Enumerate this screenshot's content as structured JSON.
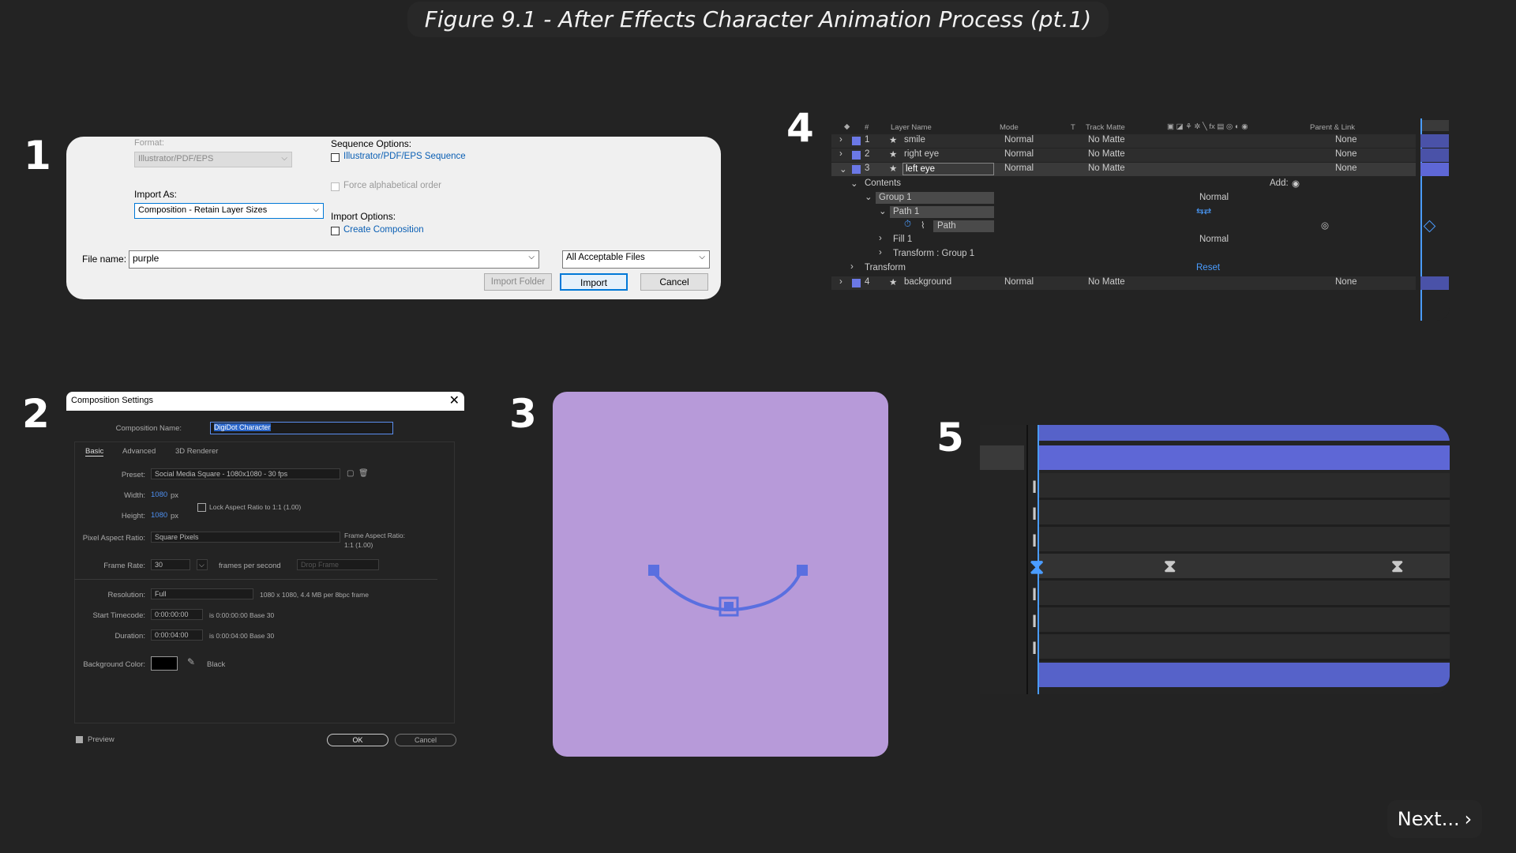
{
  "title": "Figure 9.1 - After Effects Character Animation Process (pt.1)",
  "steps": [
    "1",
    "2",
    "3",
    "4",
    "5"
  ],
  "next_label": "Next...",
  "import_dialog": {
    "format_label": "Format:",
    "format_value": "Illustrator/PDF/EPS",
    "import_as_label": "Import As:",
    "import_as_value": "Composition - Retain Layer Sizes",
    "sequence_options_label": "Sequence Options:",
    "sequence_checkbox": "Illustrator/PDF/EPS Sequence",
    "force_alpha": "Force alphabetical order",
    "import_options_label": "Import Options:",
    "create_comp": "Create Composition",
    "file_name_label": "File name:",
    "file_name_value": "purple",
    "file_type": "All Acceptable Files",
    "import_folder": "Import Folder",
    "import": "Import",
    "cancel": "Cancel"
  },
  "comp_settings": {
    "window_title": "Composition Settings",
    "comp_name_label": "Composition Name:",
    "comp_name_value": "DigiDot Character",
    "tabs": [
      "Basic",
      "Advanced",
      "3D Renderer"
    ],
    "preset_label": "Preset:",
    "preset_value": "Social Media Square  -  1080x1080 - 30 fps",
    "width_label": "Width:",
    "width_value": "1080",
    "height_label": "Height:",
    "height_value": "1080",
    "px": "px",
    "lock_aspect": "Lock Aspect Ratio to 1:1 (1.00)",
    "par_label": "Pixel Aspect Ratio:",
    "par_value": "Square Pixels",
    "far_label": "Frame Aspect Ratio:",
    "far_value": "1:1 (1.00)",
    "frame_rate_label": "Frame Rate:",
    "frame_rate_value": "30",
    "fps_text": "frames per second",
    "drop_frame": "Drop Frame",
    "resolution_label": "Resolution:",
    "resolution_value": "Full",
    "resolution_info": "1080 x 1080, 4.4 MB per 8bpc frame",
    "start_tc_label": "Start Timecode:",
    "start_tc_value": "0:00:00:00",
    "start_tc_info": "is 0:00:00:00  Base 30",
    "duration_label": "Duration:",
    "duration_value": "0:00:04:00",
    "duration_info": "is 0:00:04:00  Base 30",
    "bg_color_label": "Background Color:",
    "bg_color_name": "Black",
    "preview": "Preview",
    "ok": "OK",
    "cancel": "Cancel"
  },
  "canvas": {
    "background": "#b79ad9",
    "curve_color": "#5a6fe0"
  },
  "timeline": {
    "headers": {
      "num": "#",
      "layer_name": "Layer Name",
      "mode": "Mode",
      "t": "T",
      "track_matte": "Track Matte",
      "parent": "Parent & Link"
    },
    "layers": [
      {
        "num": "1",
        "name": "smile",
        "mode": "Normal",
        "matte": "No Matte",
        "parent": "None"
      },
      {
        "num": "2",
        "name": "right eye",
        "mode": "Normal",
        "matte": "No Matte",
        "parent": "None"
      },
      {
        "num": "3",
        "name": "left eye",
        "mode": "Normal",
        "matte": "No Matte",
        "parent": "None"
      }
    ],
    "contents": "Contents",
    "add": "Add:",
    "group1": "Group 1",
    "group1_mode": "Normal",
    "path1": "Path 1",
    "path": "Path",
    "fill1": "Fill 1",
    "fill1_mode": "Normal",
    "transform_group": "Transform : Group 1",
    "transform": "Transform",
    "reset": "Reset",
    "layer4": {
      "num": "4",
      "name": "background",
      "mode": "Normal",
      "matte": "No Matte",
      "parent": "None"
    }
  }
}
